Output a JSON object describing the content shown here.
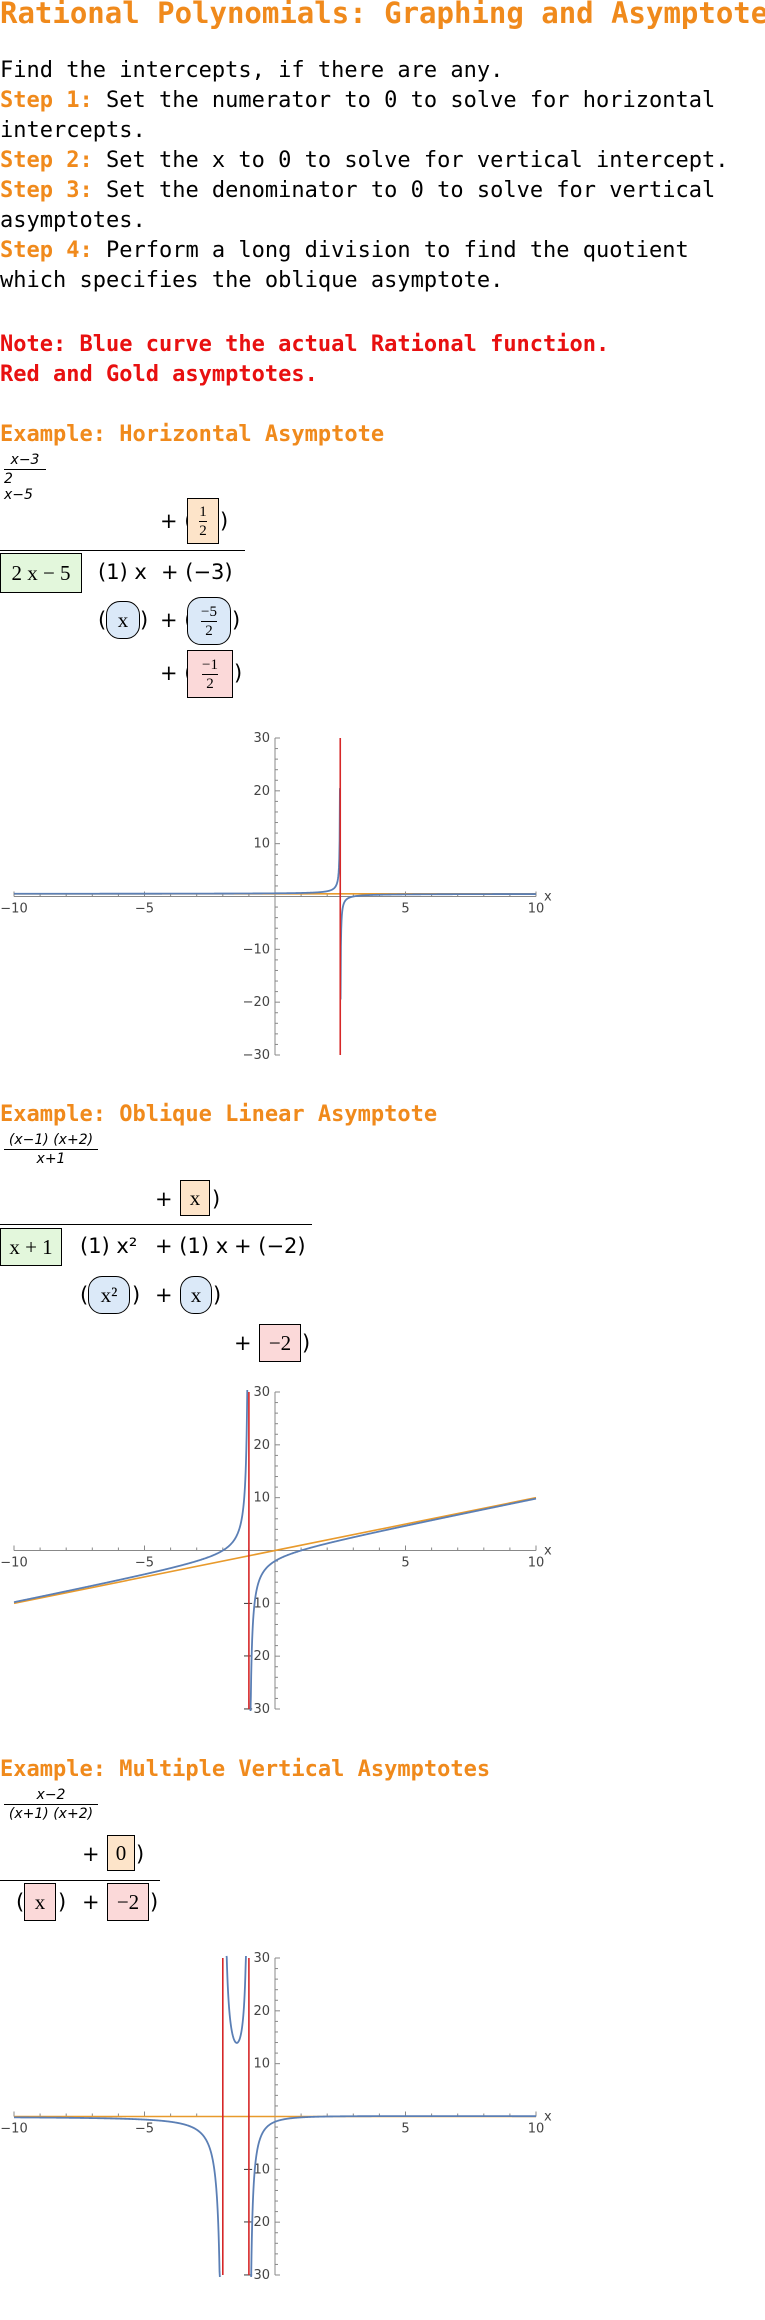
{
  "title": "Rational Polynomials: Graphing and Asymptotes",
  "steps": {
    "intro": "Find the intercepts, if there are any.",
    "items": [
      {
        "label": "Step 1:",
        "text": "Set the numerator to 0 to solve for horizontal intercepts."
      },
      {
        "label": "Step 2:",
        "text": "Set the x to 0 to solve for vertical intercept."
      },
      {
        "label": "Step 3:",
        "text": "Set the denominator to 0 to solve for vertical asymptotes."
      },
      {
        "label": "Step 4:",
        "text": "Perform a long division to find the quotient which specifies the oblique asymptote."
      }
    ]
  },
  "note": {
    "line1": "Note: Blue curve the actual Rational function.",
    "line2": "Red and Gold asymptotes."
  },
  "colors": {
    "accent": "#f08a1c",
    "note": "#e81010",
    "curve": "#5b7fb5",
    "vertical_asymptote": "#d62728",
    "other_asymptote": "#e89a2c"
  },
  "examples": [
    {
      "title": "Example: Horizontal Asymptote",
      "fraction": {
        "num": "x−3",
        "den": "2 x−5"
      },
      "division": {
        "quotient": "1/2",
        "divisor": "2 x − 5",
        "dividend": [
          "(1) x",
          "+ (−3)"
        ],
        "subtract": "x",
        "subtract2": "−5/2",
        "remainder": "−1/2"
      }
    },
    {
      "title": "Example: Oblique Linear Asymptote",
      "fraction": {
        "num": "(x−1) (x+2)",
        "den": "x+1"
      },
      "division": {
        "quotient": "x",
        "divisor": "x + 1",
        "dividend": [
          "(1) x²",
          "+ (1) x",
          "+ (−2)"
        ],
        "subtract": "x²",
        "subtract2": "x",
        "remainder": "−2"
      }
    },
    {
      "title": "Example: Multiple Vertical Asymptotes",
      "fraction": {
        "num": "x−2",
        "den": "(x+1) (x+2)"
      },
      "division": {
        "quotient": "0",
        "dividend": [
          "x",
          "−2"
        ]
      }
    }
  ],
  "chart_data": [
    {
      "type": "line",
      "function": "(x-3)/(2x-5)",
      "xlim": [
        -10,
        10
      ],
      "ylim": [
        -30,
        30
      ],
      "xticks": [
        -10,
        -5,
        5,
        10
      ],
      "yticks": [
        -30,
        -20,
        -10,
        10,
        20,
        30
      ],
      "xlabel": "x",
      "series": [
        {
          "role": "curve",
          "x": [
            -10,
            -5,
            0,
            2,
            2.4,
            2.49,
            2.51,
            2.6,
            3,
            5,
            10
          ],
          "y": [
            0.52,
            0.53,
            0.6,
            1.0,
            3.0,
            26.0,
            -24.0,
            -2.0,
            0.0,
            0.4,
            0.47
          ]
        },
        {
          "role": "vertical-asymptote",
          "x": 2.5
        },
        {
          "role": "horizontal-asymptote",
          "y": 0.5
        }
      ]
    },
    {
      "type": "line",
      "function": "(x-1)(x+2)/(x+1)",
      "xlim": [
        -10,
        10
      ],
      "ylim": [
        -30,
        30
      ],
      "xticks": [
        -10,
        -5,
        5,
        10
      ],
      "yticks": [
        -30,
        -20,
        -10,
        10,
        20,
        30
      ],
      "xlabel": "x",
      "series": [
        {
          "role": "curve",
          "x": [
            -10,
            -5,
            -2,
            -1.5,
            -1.1,
            -1.07,
            -0.93,
            -0.9,
            -0.5,
            0,
            2,
            5,
            10
          ],
          "y": [
            -8.78,
            -3.5,
            0.0,
            2.5,
            19.0,
            28.0,
            -30.0,
            -20.0,
            -4.5,
            -2.0,
            1.33,
            4.67,
            9.82
          ]
        },
        {
          "role": "vertical-asymptote",
          "x": -1
        },
        {
          "role": "oblique-asymptote",
          "slope": 1,
          "intercept": 0
        }
      ]
    },
    {
      "type": "line",
      "function": "(x-2)/((x+1)(x+2))",
      "xlim": [
        -10,
        10
      ],
      "ylim": [
        -30,
        30
      ],
      "xticks": [
        -10,
        -5,
        5,
        10
      ],
      "yticks": [
        -30,
        -20,
        -10,
        10,
        20,
        30
      ],
      "xlabel": "x",
      "series": [
        {
          "role": "curve",
          "x": [
            -10,
            -5,
            -3,
            -2.1,
            -2.05,
            -1.96,
            -1.5,
            -1.04,
            -0.96,
            -0.8,
            0,
            2,
            5,
            10
          ],
          "y": [
            -0.17,
            -0.58,
            -2.5,
            -37.0,
            -75.0,
            100.0,
            14.0,
            100.0,
            -72.0,
            -17.0,
            -1.0,
            0.0,
            0.07,
            0.06
          ]
        },
        {
          "role": "vertical-asymptote",
          "x": -2
        },
        {
          "role": "vertical-asymptote",
          "x": -1
        },
        {
          "role": "horizontal-asymptote",
          "y": 0
        }
      ]
    }
  ]
}
